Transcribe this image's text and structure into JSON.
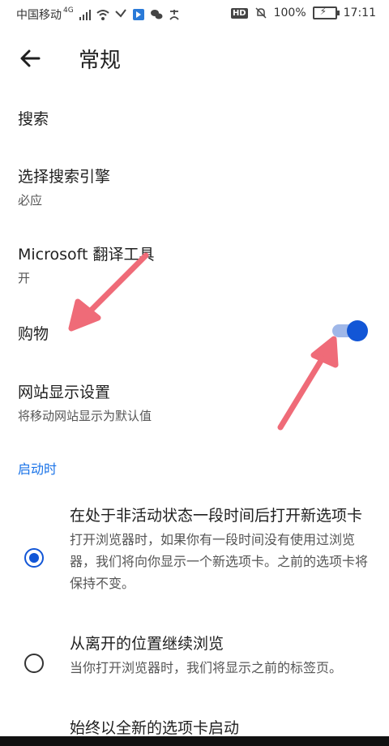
{
  "status_bar": {
    "carrier": "中国移动",
    "network": "4G",
    "right_badge": "HD",
    "battery": "100%",
    "time": "17:11"
  },
  "header": {
    "title": "常规"
  },
  "items": [
    {
      "title": "搜索",
      "subtitle": ""
    },
    {
      "title": "选择搜索引擎",
      "subtitle": "必应"
    },
    {
      "title": "Microsoft 翻译工具",
      "subtitle": "开"
    },
    {
      "title": "购物",
      "subtitle": "",
      "toggle_on": true
    },
    {
      "title": "网站显示设置",
      "subtitle": "将移动网站显示为默认值"
    }
  ],
  "startup": {
    "section_title": "启动时",
    "options": [
      {
        "title": "在处于非活动状态一段时间后打开新选项卡",
        "desc": "打开浏览器时，如果你有一段时间没有使用过浏览器，我们将向你显示一个新选项卡。之前的选项卡将保持不变。",
        "selected": true
      },
      {
        "title": "从离开的位置继续浏览",
        "desc": "当你打开浏览器时，我们将显示之前的标签页。",
        "selected": false
      },
      {
        "title": "始终以全新的选项卡启动",
        "desc": "",
        "selected": false
      }
    ]
  },
  "colors": {
    "accent": "#1256d6",
    "section_title": "#1a73e8",
    "annotation_arrow": "#ef6b78"
  }
}
